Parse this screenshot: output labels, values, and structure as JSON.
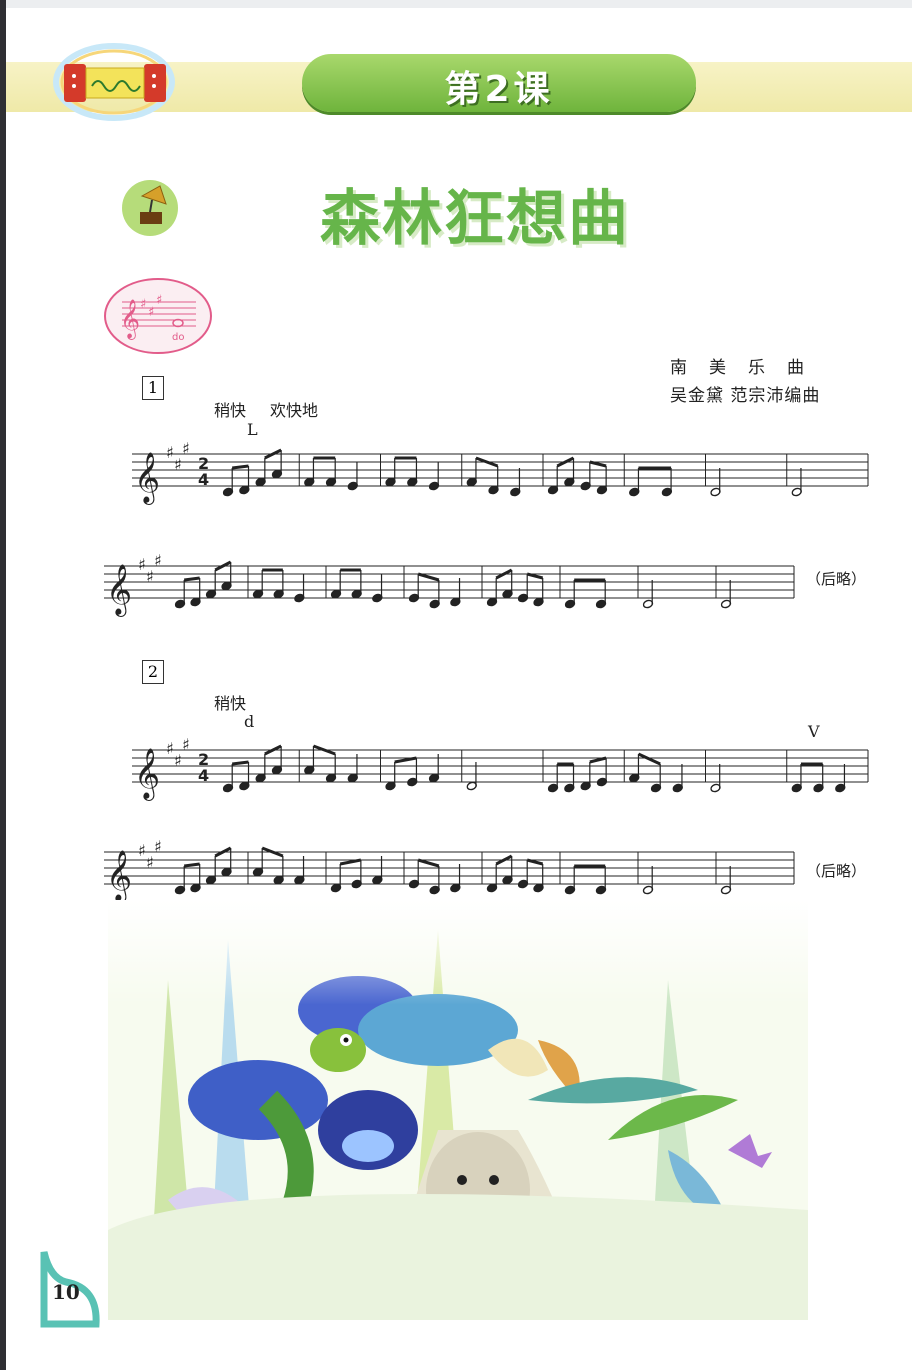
{
  "lesson": {
    "label": "第2课"
  },
  "song": {
    "title": "森林狂想曲"
  },
  "credits": {
    "origin": "南美乐曲",
    "arrangers": "吴金黛 范宗沛编曲"
  },
  "key_badge": {
    "note_label": "do"
  },
  "exercises": [
    {
      "number": "1",
      "tempo": "稍快",
      "mood": "欢快地",
      "breath_marks": [
        "L"
      ],
      "ending": "（后略）"
    },
    {
      "number": "2",
      "tempo": "稍快",
      "breath_marks": [
        "d",
        "V"
      ],
      "ending": "（后略）"
    }
  ],
  "time_signature": {
    "top": "2",
    "bottom": "4"
  },
  "page": {
    "number": "10"
  },
  "colors": {
    "title_green": "#66b54a",
    "pill_green": "#7dbd45",
    "band_yellow": "#f2eeb4"
  }
}
